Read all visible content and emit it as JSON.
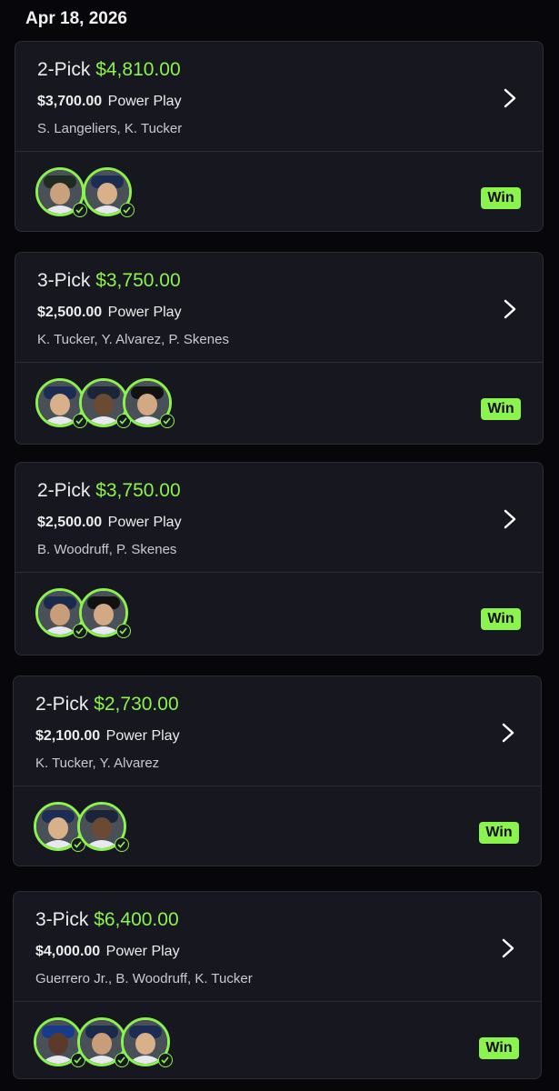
{
  "header": {
    "date": "Apr 18, 2026"
  },
  "colors": {
    "accent": "#8bf34d",
    "card": "#17181f",
    "background": "#07070b"
  },
  "cards": [
    {
      "pick": "2-Pick",
      "payout": "$4,810.00",
      "entry": "$3,700.00",
      "play_type": "Power Play",
      "players": "S. Langeliers, K. Tucker",
      "status": "Win",
      "avatars": [
        "langeliers",
        "tucker"
      ]
    },
    {
      "pick": "3-Pick",
      "payout": "$3,750.00",
      "entry": "$2,500.00",
      "play_type": "Power Play",
      "players": "K. Tucker, Y. Alvarez, P. Skenes",
      "status": "Win",
      "avatars": [
        "tucker",
        "alvarez",
        "skenes"
      ]
    },
    {
      "pick": "2-Pick",
      "payout": "$3,750.00",
      "entry": "$2,500.00",
      "play_type": "Power Play",
      "players": "B. Woodruff, P. Skenes",
      "status": "Win",
      "avatars": [
        "woodruff",
        "skenes"
      ]
    },
    {
      "pick": "2-Pick",
      "payout": "$2,730.00",
      "entry": "$2,100.00",
      "play_type": "Power Play",
      "players": "K. Tucker, Y. Alvarez",
      "status": "Win",
      "avatars": [
        "tucker",
        "alvarez"
      ]
    },
    {
      "pick": "3-Pick",
      "payout": "$6,400.00",
      "entry": "$4,000.00",
      "play_type": "Power Play",
      "players": "Guerrero Jr., B. Woodruff, K. Tucker",
      "status": "Win",
      "avatars": [
        "guerrero",
        "woodruff",
        "tucker"
      ]
    }
  ]
}
